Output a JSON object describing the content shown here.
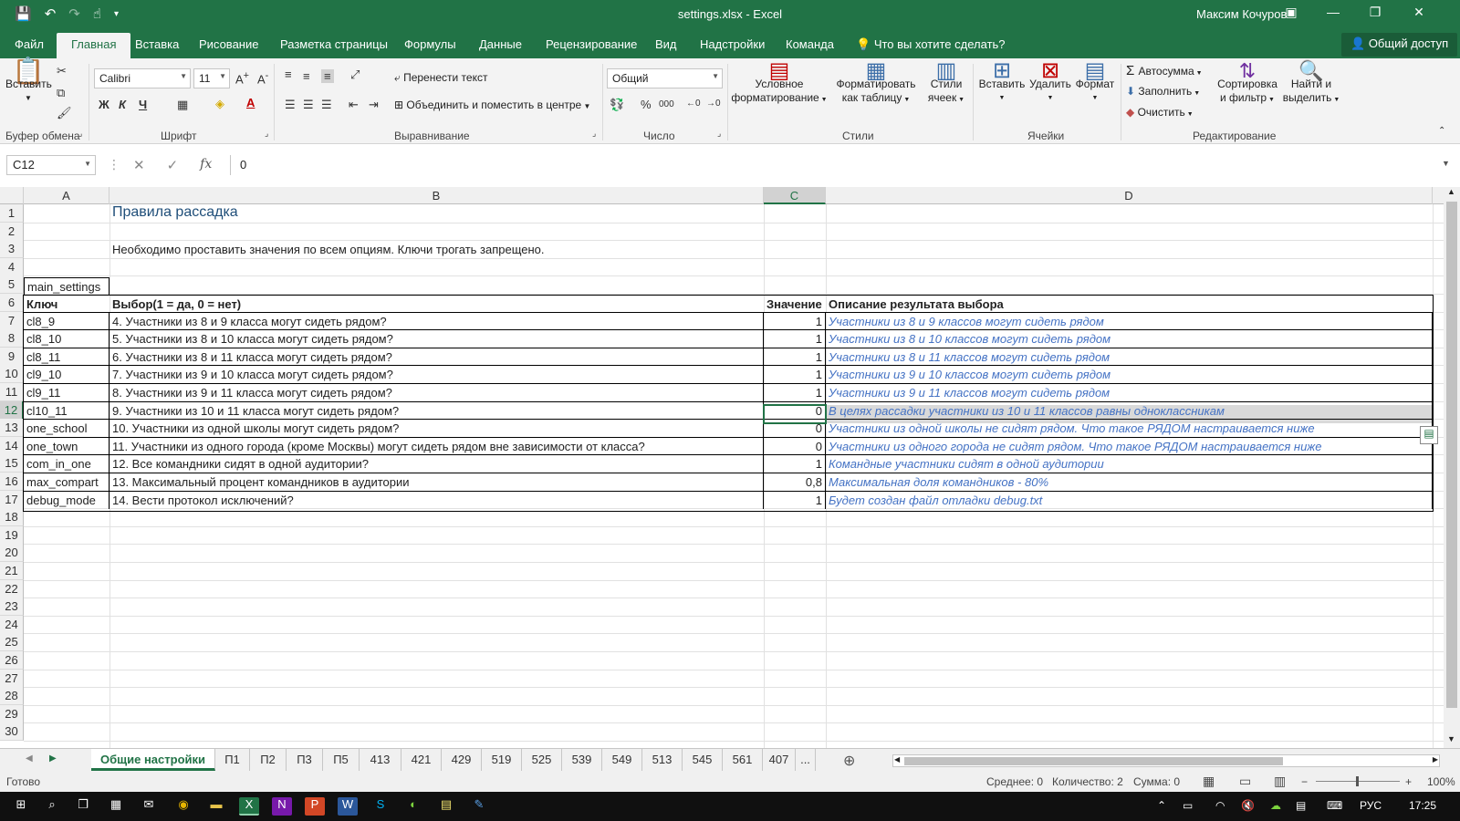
{
  "window": {
    "title": "settings.xlsx - Excel",
    "user": "Максим Кочуров"
  },
  "ribbon_tabs": [
    "Файл",
    "Главная",
    "Вставка",
    "Рисование",
    "Разметка страницы",
    "Формулы",
    "Данные",
    "Рецензирование",
    "Вид",
    "Надстройки",
    "Команда",
    "Что вы хотите сделать?"
  ],
  "share_label": "Общий доступ",
  "ribbon": {
    "paste": "Вставить",
    "font_name": "Calibri",
    "font_size": "11",
    "bold": "Ж",
    "italic": "К",
    "underline": "Ч",
    "wrap_text": "Перенести текст",
    "merge_center": "Объединить и поместить в центре",
    "number_format": "Общий",
    "cond_format_1": "Условное",
    "cond_format_2": "форматирование",
    "format_table_1": "Форматировать",
    "format_table_2": "как таблицу",
    "cell_styles_1": "Стили",
    "cell_styles_2": "ячеек",
    "insert": "Вставить",
    "delete": "Удалить",
    "format": "Формат",
    "autosum": "Автосумма",
    "fill": "Заполнить",
    "clear": "Очистить",
    "sort_1": "Сортировка",
    "sort_2": "и фильтр",
    "find_1": "Найти и",
    "find_2": "выделить",
    "groups": {
      "clipboard": "Буфер обмена",
      "font": "Шрифт",
      "alignment": "Выравнивание",
      "number": "Число",
      "styles": "Стили",
      "cells": "Ячейки",
      "editing": "Редактирование"
    }
  },
  "formula_bar": {
    "name_box": "C12",
    "formula": "0",
    "fx": "fx"
  },
  "columns": [
    "A",
    "B",
    "C",
    "D"
  ],
  "row_numbers": [
    "1",
    "2",
    "3",
    "4",
    "5",
    "6",
    "7",
    "8",
    "9",
    "10",
    "11",
    "12",
    "13",
    "14",
    "15",
    "16",
    "17",
    "18",
    "19",
    "20",
    "21",
    "22",
    "23",
    "24",
    "25",
    "26",
    "27",
    "28",
    "29",
    "30"
  ],
  "sheet": {
    "title": "Правила рассадка",
    "note": "Необходимо проставить значения по всем опциям. Ключи трогать запрещено.",
    "section": "main_settings",
    "headers": [
      "Ключ",
      "Выбор(1 = да, 0 = нет)",
      "Значение",
      "Описание результата выбора"
    ],
    "rows": [
      [
        "cl8_9",
        "4. Участники из 8 и 9 класса могут сидеть рядом?",
        "1",
        "Участники из 8 и 9 классов могут сидеть рядом"
      ],
      [
        "cl8_10",
        "5. Участники из 8 и 10 класса могут сидеть рядом?",
        "1",
        "Участники из 8 и 10 классов могут сидеть рядом"
      ],
      [
        "cl8_11",
        "6. Участники из 8 и 11 класса могут сидеть рядом?",
        "1",
        "Участники из 8 и 11 классов могут сидеть рядом"
      ],
      [
        "cl9_10",
        "7. Участники из 9 и 10 класса могут сидеть рядом?",
        "1",
        "Участники из 9 и 10 классов могут сидеть рядом"
      ],
      [
        "cl9_11",
        "8. Участники из 9 и 11 класса могут сидеть рядом?",
        "1",
        "Участники из 9 и 11 классов могут сидеть рядом"
      ],
      [
        "cl10_11",
        "9. Участники из 10 и 11 класса могут сидеть рядом?",
        "0",
        "В целях рассадки участники из 10 и 11 классов равны одноклассникам"
      ],
      [
        "one_school",
        "10. Участники из одной школы могут сидеть рядом?",
        "0",
        "Участники из одной школы не сидят рядом. Что такое РЯДОМ настраивается ниже"
      ],
      [
        "one_town",
        "11. Участники из одного города (кроме Москвы) могут сидеть рядом вне зависимости от класса?",
        "0",
        "Участники из одного города не сидят рядом. Что такое РЯДОМ настраивается ниже"
      ],
      [
        "com_in_one",
        "12. Все командники сидят в одной аудитории?",
        "1",
        "Командные участники сидят в одной аудитории"
      ],
      [
        "max_compart",
        "13. Максимальный процент командников в аудитории",
        "0,8",
        "Максимальная доля командников - 80%"
      ],
      [
        "debug_mode",
        "14. Вести протокол исключений?",
        "1",
        "Будет создан файл отладки debug.txt"
      ]
    ]
  },
  "sheet_tabs": [
    "Общие настройки",
    "П1",
    "П2",
    "П3",
    "П5",
    "413",
    "421",
    "429",
    "519",
    "525",
    "539",
    "549",
    "513",
    "545",
    "561",
    "407",
    "..."
  ],
  "status": {
    "ready": "Готово",
    "average": "Среднее: 0",
    "count": "Количество: 2",
    "sum": "Сумма: 0",
    "zoom": "100%"
  },
  "taskbar": {
    "lang": "РУС",
    "time": "17:25"
  }
}
